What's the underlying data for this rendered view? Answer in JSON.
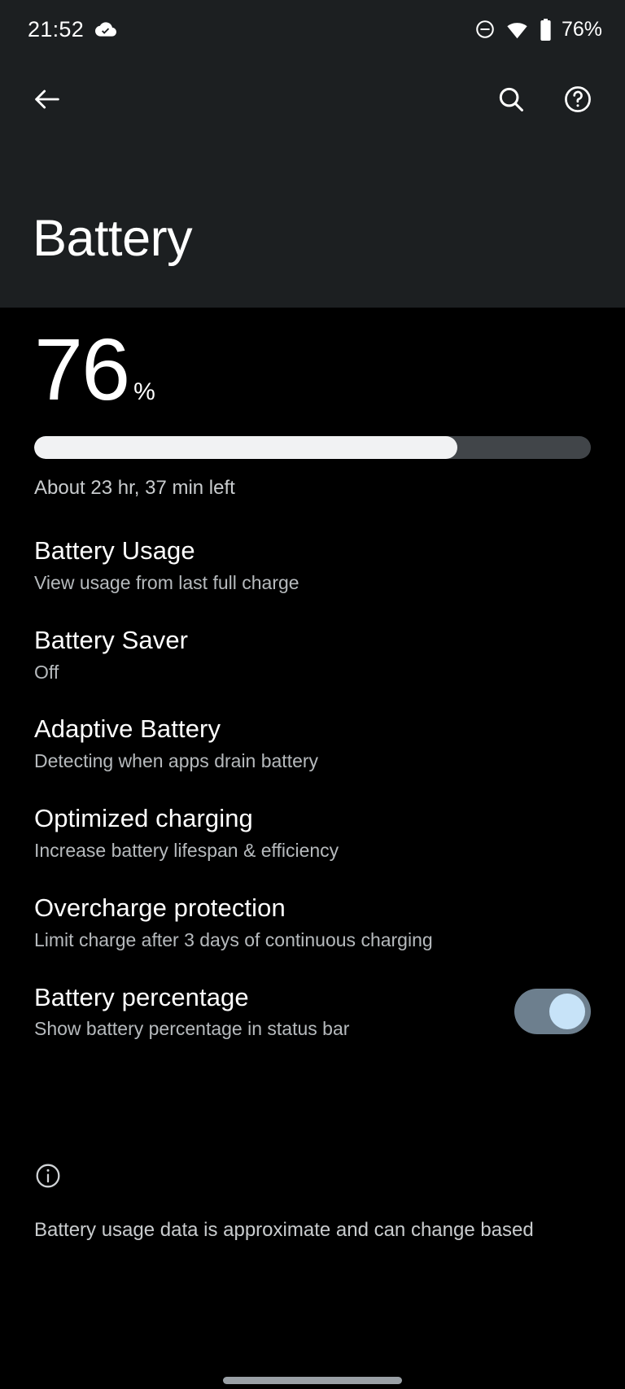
{
  "status_bar": {
    "clock": "21:52",
    "cloud_sync_icon": "cloud-check-icon",
    "dnd_icon": "do-not-disturb-icon",
    "wifi_icon": "wifi-icon",
    "battery_icon": "battery-icon",
    "battery_text": "76%"
  },
  "app_bar": {
    "back_icon": "back-arrow-icon",
    "search_icon": "search-icon",
    "help_icon": "help-icon",
    "title": "Battery"
  },
  "battery_level": {
    "value": "76",
    "percent_symbol": "%",
    "percent_number": 76,
    "estimate": "About 23 hr, 37 min left"
  },
  "preferences": [
    {
      "name": "battery-usage",
      "title": "Battery Usage",
      "summary": "View usage from last full charge",
      "has_switch": false
    },
    {
      "name": "battery-saver",
      "title": "Battery Saver",
      "summary": "Off",
      "has_switch": false
    },
    {
      "name": "adaptive-battery",
      "title": "Adaptive Battery",
      "summary": "Detecting when apps drain battery",
      "has_switch": false
    },
    {
      "name": "optimized-charging",
      "title": "Optimized charging",
      "summary": "Increase battery lifespan & efficiency",
      "has_switch": false
    },
    {
      "name": "overcharge-protection",
      "title": "Overcharge protection",
      "summary": "Limit charge after 3 days of continuous charging",
      "has_switch": false
    },
    {
      "name": "battery-percentage",
      "title": "Battery percentage",
      "summary": "Show battery percentage in status bar",
      "has_switch": true,
      "switch_on": true
    }
  ],
  "footer": {
    "info_icon": "info-icon",
    "text": "Battery usage data is approximate and can change based"
  },
  "nav": {
    "pill": "home-gesture-pill"
  },
  "colors": {
    "background": "#000000",
    "appbar_background": "#1c1f21",
    "primary_text": "#ffffff",
    "secondary_text": "#b6babd",
    "bar_fill": "#f1f2f3",
    "bar_track": "#414549",
    "switch_track_on": "#6d7f8e",
    "switch_thumb_on": "#c7e3f8"
  }
}
